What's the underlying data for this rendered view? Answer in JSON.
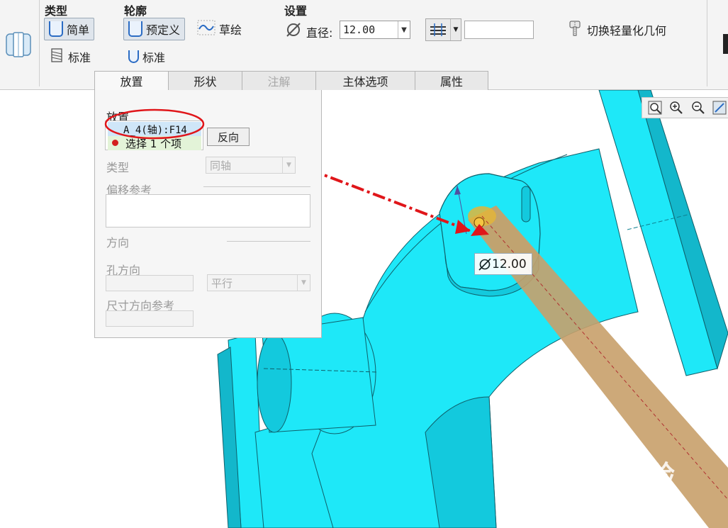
{
  "ribbon": {
    "groups": {
      "type": "类型",
      "profile": "轮廓",
      "settings": "设置"
    },
    "type_simple": "简单",
    "type_standard": "标准",
    "profile_predefined": "预定义",
    "profile_sketch": "草绘",
    "profile_standard": "标准",
    "diameter_label": "直径:",
    "diameter_value": "12.00",
    "toggle_lightweight": "切换轻量化几何"
  },
  "tabs": [
    {
      "label": "放置",
      "state": "active"
    },
    {
      "label": "形状",
      "state": "normal"
    },
    {
      "label": "注解",
      "state": "disabled"
    },
    {
      "label": "主体选项",
      "state": "normal"
    },
    {
      "label": "属性",
      "state": "normal"
    }
  ],
  "panel": {
    "placement_label": "放置",
    "collector_item": "A_4(轴):F14",
    "collector_prompt": "选择 1 个项",
    "flip_button": "反向",
    "type_label": "类型",
    "type_value": "同轴",
    "offset_refs_label": "偏移参考",
    "direction_label": "方向",
    "hole_direction_label": "孔方向",
    "hole_direction_value": "平行",
    "dim_direction_label": "尺寸方向参考"
  },
  "graphics": {
    "dimension_label": "12.00"
  },
  "watermark": {
    "brand": "Bai 经验",
    "url": "jingyan.baidu.com"
  },
  "colors": {
    "model": "#1ee8f8",
    "model_shade": "#13b7cb",
    "preview_rod": "#c8a06a",
    "annotation_red": "#e0161a",
    "ribbon_bg": "#f4f4f4"
  }
}
